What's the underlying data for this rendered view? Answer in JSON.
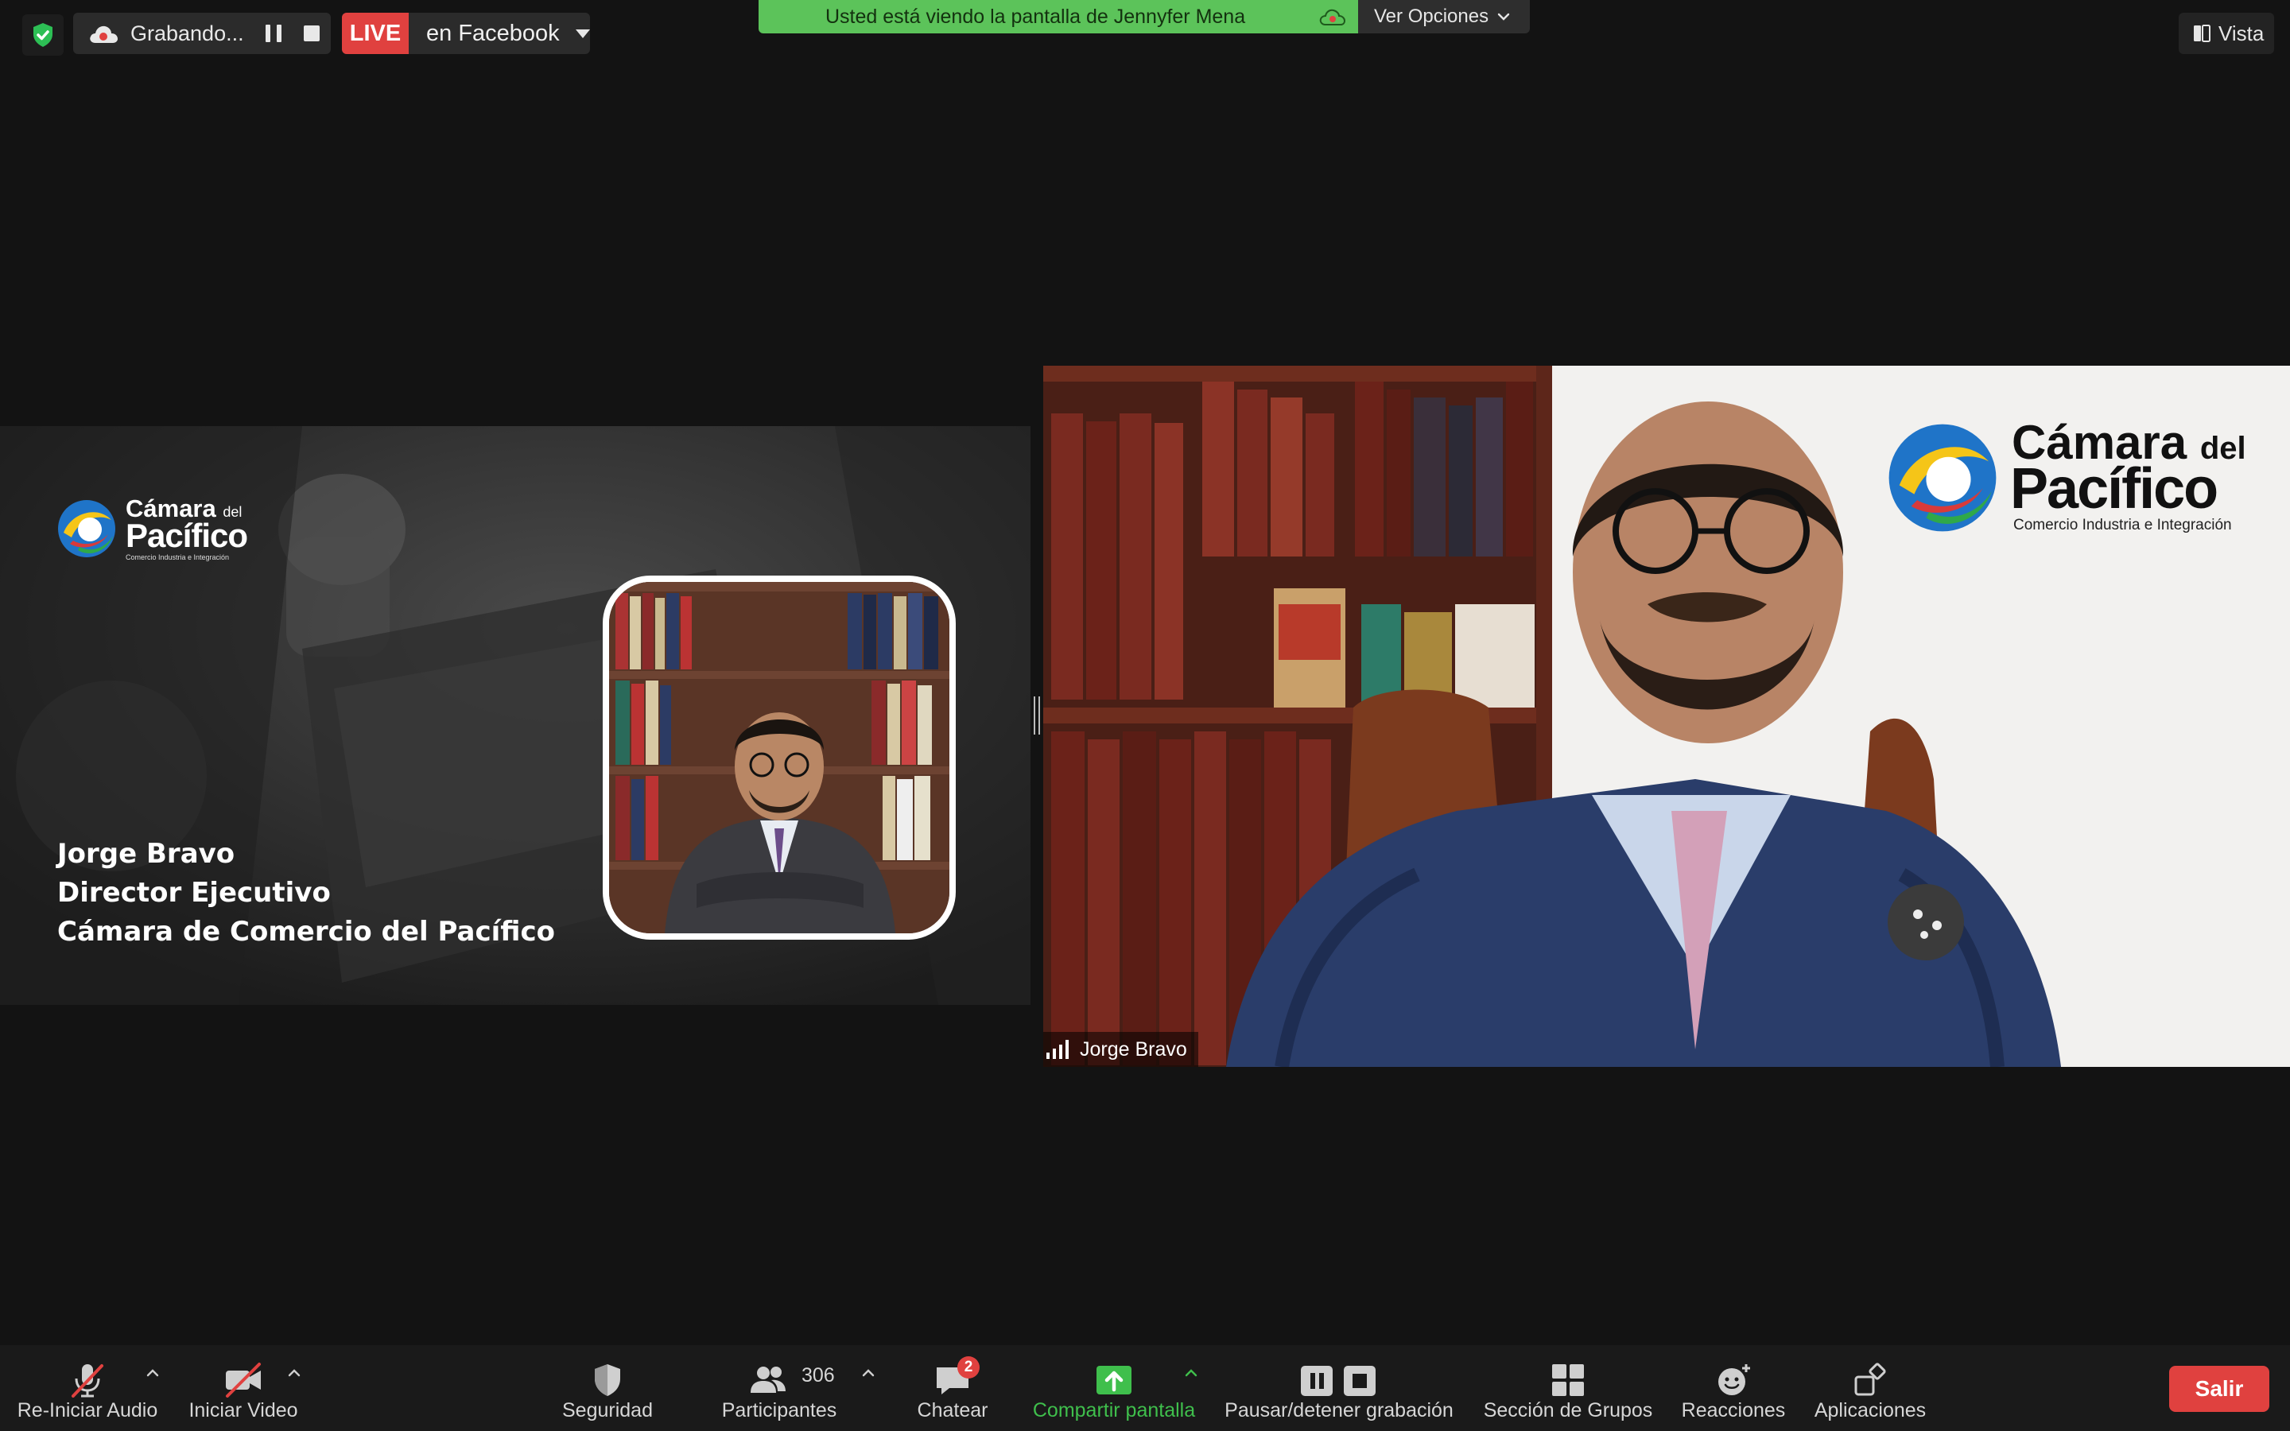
{
  "recording": {
    "label": "Grabando..."
  },
  "live": {
    "badge": "LIVE",
    "target": "en Facebook"
  },
  "notice": {
    "text": "Usted está viendo la pantalla de Jennyfer Mena",
    "options_label": "Ver Opciones"
  },
  "view": {
    "label": "Vista"
  },
  "slide": {
    "logo": {
      "line1": "Cámara",
      "line1_small": "del",
      "line2": "Pacífico",
      "tagline": "Comercio Industria e Integración"
    },
    "lines": [
      "Jorge Bravo",
      "Director Ejecutivo",
      "Cámara de Comercio del Pacífico"
    ]
  },
  "video": {
    "logo": {
      "line1": "Cámara",
      "line1_small": "del",
      "line2": "Pacífico",
      "tagline": "Comercio Industria e Integración"
    },
    "participant_name": "Jorge Bravo"
  },
  "toolbar": {
    "audio_label": "Re-Iniciar Audio",
    "video_label": "Iniciar Video",
    "security_label": "Seguridad",
    "participants_label": "Participantes",
    "participants_count": "306",
    "chat_label": "Chatear",
    "chat_badge": "2",
    "share_label": "Compartir pantalla",
    "record_label": "Pausar/detener grabación",
    "breakout_label": "Sección de Grupos",
    "reactions_label": "Reacciones",
    "apps_label": "Aplicaciones",
    "leave_label": "Salir"
  },
  "colors": {
    "accent_green": "#5cc35a",
    "danger_red": "#e0413f",
    "share_green": "#3fbf4c",
    "background": "#131313"
  }
}
